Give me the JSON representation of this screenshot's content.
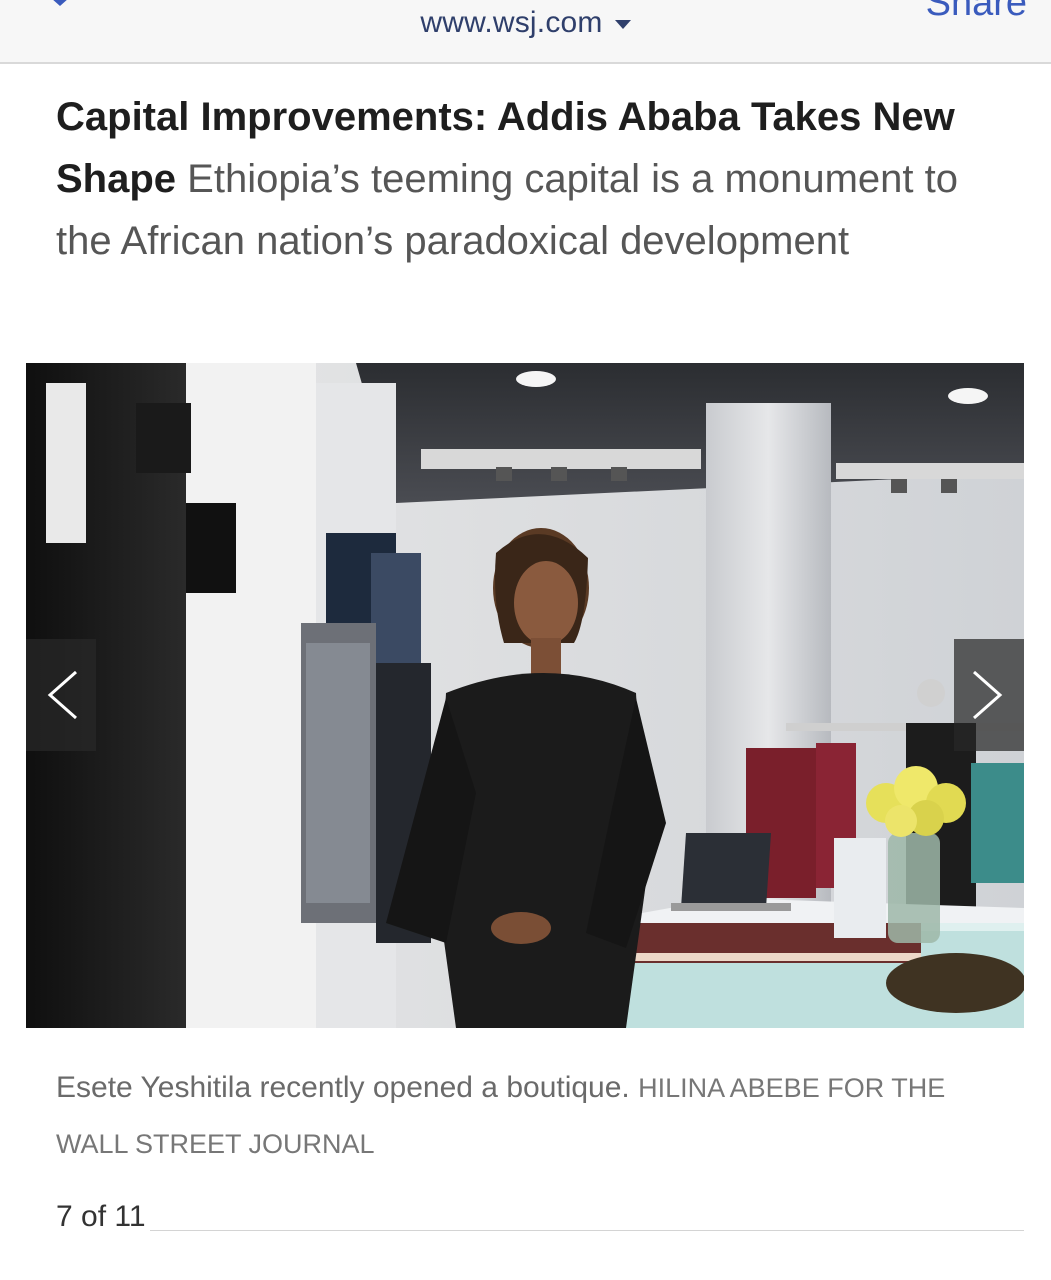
{
  "browser": {
    "url_label": "www.wsj.com",
    "share_label": "Share"
  },
  "article": {
    "title": "Capital Improvements: Addis Ababa Takes New Shape",
    "dek": "Ethiopia’s teeming capital is a monument to the African nation’s paradoxical development"
  },
  "slideshow": {
    "photo_alt": "Esete Yeshitila recently opened a boutique.",
    "caption": "Esete Yeshitila recently opened a boutique.",
    "credit": "HILINA ABEBE FOR THE WALL STREET JOURNAL",
    "counter": "7 of 11",
    "prev_icon": "chevron-left-icon",
    "next_icon": "chevron-right-icon"
  },
  "colors": {
    "url_text": "#2f3f6b",
    "share_link": "#3a5bbd",
    "title_text": "#1e1e1e",
    "dek_text": "#565656",
    "caption_text": "#6a6a6a"
  }
}
